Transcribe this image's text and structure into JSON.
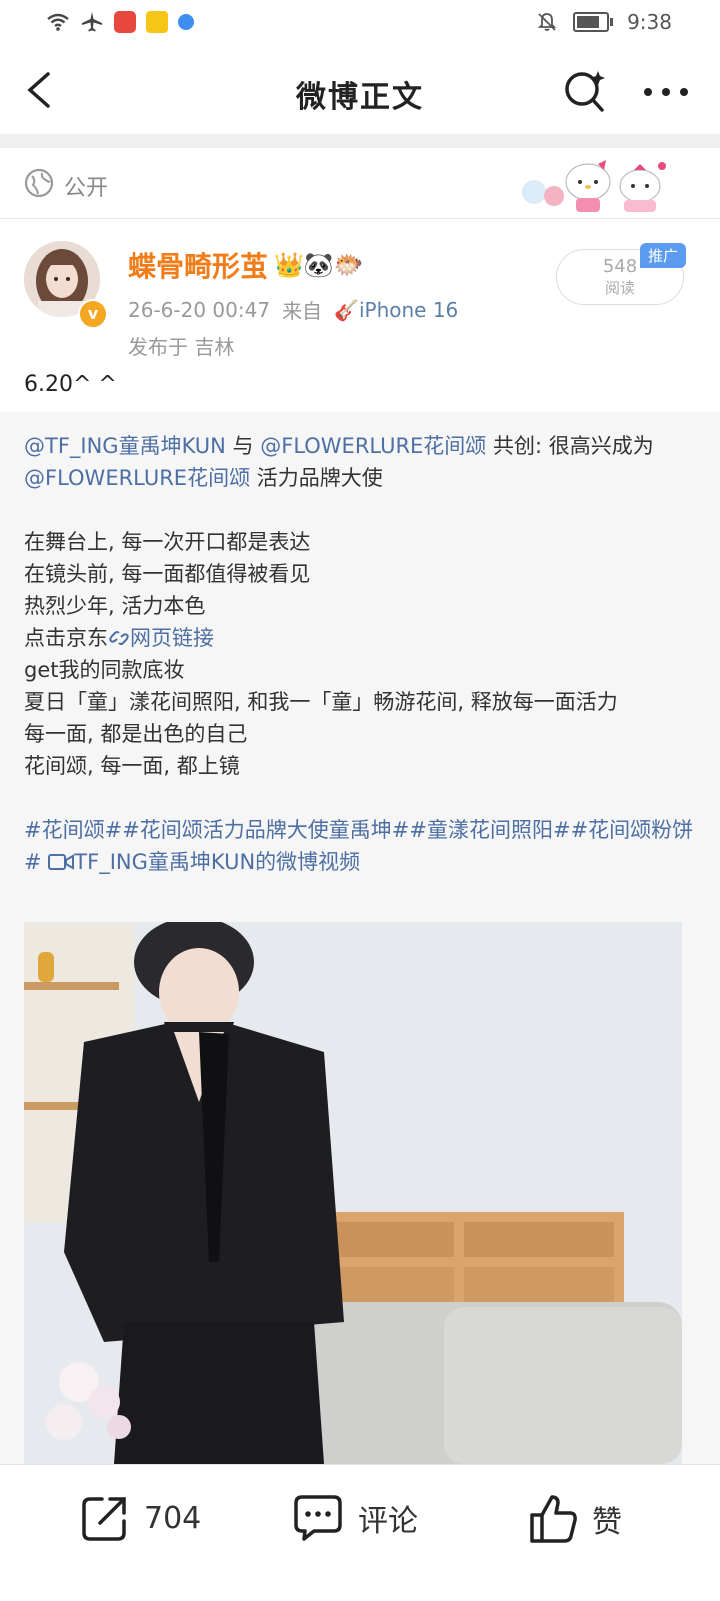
{
  "status_bar": {
    "time": "9:38",
    "icons": [
      "wifi-icon",
      "airplane-icon",
      "app-icon-red",
      "weibo-app-icon",
      "blue-app-icon",
      "mute-bell-icon",
      "battery-icon"
    ]
  },
  "nav": {
    "title": "微博正文",
    "back_icon": "chevron-left-icon",
    "search_icon": "search-sparkle-icon",
    "more_icon": "more-dots-icon"
  },
  "visibility": {
    "label": "公开",
    "icon": "globe-icon"
  },
  "author": {
    "name": "蝶骨畸形茧",
    "name_emoji": "👑🐼🐡",
    "badge": "v",
    "time": "26-6-20 00:47",
    "source_prefix": "来自",
    "source_emoji": "🎸",
    "source": "iPhone 16",
    "location": "发布于 吉林",
    "reads_count": "548",
    "reads_unit": "阅读",
    "promote_tag": "推广"
  },
  "post": {
    "short_text": "6.20^ ^"
  },
  "repost": {
    "line1_mention": "@TF_ING童禹坤KUN",
    "line1_mid": " 与 ",
    "line1_mention2": "@FLOWERLURE花间颂",
    "line1_tail": " 共创: 很高兴成为",
    "line2_mention": "@FLOWERLURE花间颂",
    "line2_tail": " 活力品牌大使",
    "body_lines": [
      "在舞台上, 每一次开口都是表达",
      "在镜头前, 每一面都值得被看见",
      "热烈少年, 活力本色"
    ],
    "click_prefix": "点击京东",
    "web_link": "网页链接",
    "lines_after": [
      "get我的同款底妆",
      "夏日「童」漾花间照阳, 和我一「童」畅游花间, 释放每一面活力",
      "每一面, 都是出色的自己",
      "花间颂, 每一面, 都上镜"
    ],
    "hashtags": "#花间颂##花间颂活力品牌大使童禹坤##童漾花间照阳##花间颂粉饼#",
    "video_link": "TF_ING童禹坤KUN的微博视频"
  },
  "actions": {
    "repost_count": "704",
    "comment_label": "评论",
    "like_label": "赞"
  },
  "colors": {
    "link": "#4d6fa3",
    "username": "#f07d19",
    "promote": "#5b9cf0"
  }
}
